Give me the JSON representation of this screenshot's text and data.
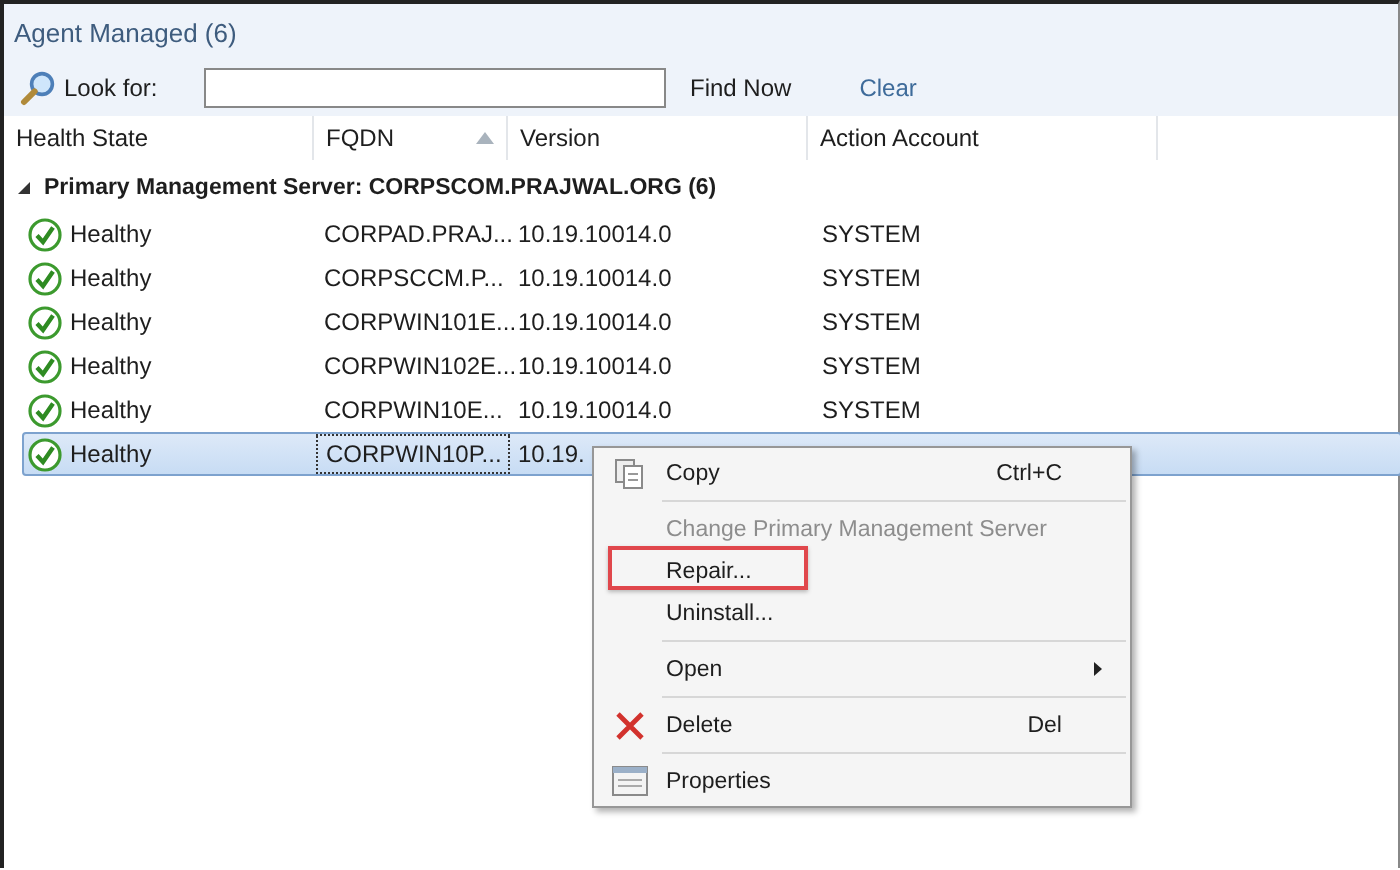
{
  "panel": {
    "title": "Agent Managed (6)"
  },
  "search": {
    "label": "Look for:",
    "find_button": "Find Now",
    "clear_link": "Clear"
  },
  "table": {
    "columns": [
      {
        "label": "Health State",
        "sorted": false
      },
      {
        "label": "FQDN",
        "sorted": true
      },
      {
        "label": "Version",
        "sorted": false
      },
      {
        "label": "Action Account",
        "sorted": false
      }
    ],
    "group": {
      "label": "Primary Management Server: CORPSCOM.PRAJWAL.ORG (6)",
      "expanded": true
    },
    "rows": [
      {
        "health": "Healthy",
        "fqdn": "CORPAD.PRAJ...",
        "version": "10.19.10014.0",
        "account": "SYSTEM",
        "selected": false
      },
      {
        "health": "Healthy",
        "fqdn": "CORPSCCM.P...",
        "version": "10.19.10014.0",
        "account": "SYSTEM",
        "selected": false
      },
      {
        "health": "Healthy",
        "fqdn": "CORPWIN101E...",
        "version": "10.19.10014.0",
        "account": "SYSTEM",
        "selected": false
      },
      {
        "health": "Healthy",
        "fqdn": "CORPWIN102E...",
        "version": "10.19.10014.0",
        "account": "SYSTEM",
        "selected": false
      },
      {
        "health": "Healthy",
        "fqdn": "CORPWIN10E...",
        "version": "10.19.10014.0",
        "account": "SYSTEM",
        "selected": false
      },
      {
        "health": "Healthy",
        "fqdn": "CORPWIN10P...",
        "version": "10.19.",
        "selected": true
      }
    ]
  },
  "context_menu": {
    "items": [
      {
        "kind": "copy",
        "label": "Copy",
        "shortcut": "Ctrl+C",
        "disabled": false,
        "highlighted": false
      },
      {
        "kind": "separator"
      },
      {
        "kind": "item",
        "label": "Change Primary Management Server",
        "disabled": true,
        "highlighted": false
      },
      {
        "kind": "item",
        "label": "Repair...",
        "disabled": false,
        "highlighted": true
      },
      {
        "kind": "item",
        "label": "Uninstall...",
        "disabled": false,
        "highlighted": false
      },
      {
        "kind": "separator"
      },
      {
        "kind": "submenu",
        "label": "Open",
        "disabled": false,
        "highlighted": false
      },
      {
        "kind": "separator"
      },
      {
        "kind": "delete",
        "label": "Delete",
        "shortcut": "Del",
        "disabled": false,
        "highlighted": false
      },
      {
        "kind": "separator"
      },
      {
        "kind": "properties",
        "label": "Properties",
        "disabled": false,
        "highlighted": false
      }
    ]
  }
}
